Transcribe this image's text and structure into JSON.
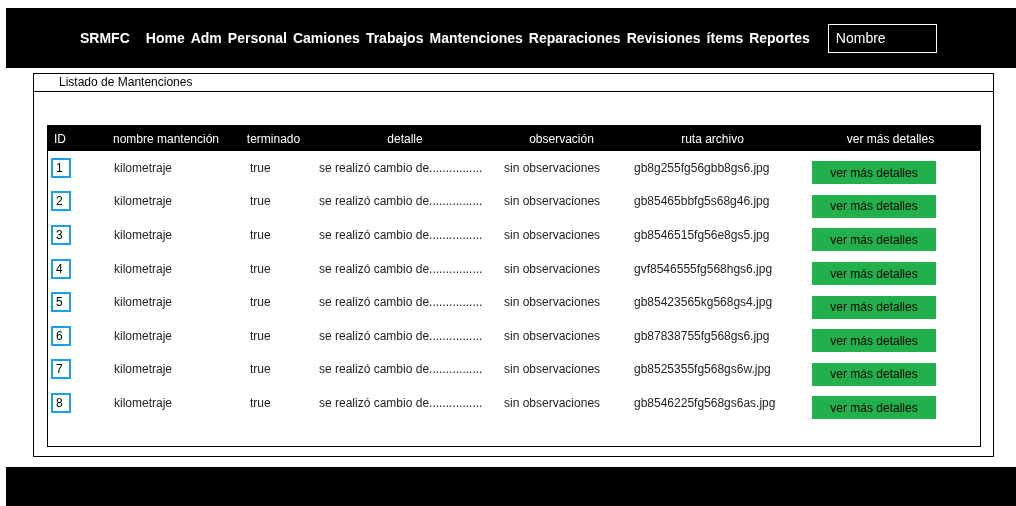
{
  "nav": {
    "brand": "SRMFC",
    "links": [
      "Home",
      "Adm",
      "Personal",
      "Camiones",
      "Trabajos",
      "Mantenciones",
      "Reparaciones",
      "Revisiones",
      "ítems",
      "Reportes"
    ],
    "search": {
      "placeholder": "Nombre"
    }
  },
  "panel": {
    "title": "Listado de Mantenciones"
  },
  "table": {
    "columns": [
      "ID",
      "nombre mantención",
      "terminado",
      "detalle",
      "observación",
      "ruta archivo",
      "ver más detalles"
    ],
    "rows": [
      {
        "id": "1",
        "name": "kilometraje",
        "done": "true",
        "detail": "se realizó cambio de................",
        "observation": "sin observaciones",
        "file": "gb8g255fg56gbb8gs6.jpg",
        "action": "ver más detalles"
      },
      {
        "id": "2",
        "name": "kilometraje",
        "done": "true",
        "detail": "se realizó cambio de................",
        "observation": "sin observaciones",
        "file": "gb85465bbfg5s68g46.jpg",
        "action": "ver más detalles"
      },
      {
        "id": "3",
        "name": "kilometraje",
        "done": "true",
        "detail": "se realizó cambio de................",
        "observation": "sin observaciones",
        "file": "gb8546515fg56e8gs5.jpg",
        "action": "ver más detalles"
      },
      {
        "id": "4",
        "name": "kilometraje",
        "done": "true",
        "detail": "se realizó cambio de................",
        "observation": "sin observaciones",
        "file": "gvf8546555fg568hgs6.jpg",
        "action": "ver más detalles"
      },
      {
        "id": "5",
        "name": "kilometraje",
        "done": "true",
        "detail": "se realizó cambio de................",
        "observation": "sin observaciones",
        "file": "gb85423565kg568gs4.jpg",
        "action": "ver más detalles"
      },
      {
        "id": "6",
        "name": "kilometraje",
        "done": "true",
        "detail": "se realizó cambio de................",
        "observation": "sin observaciones",
        "file": "gb87838755fg568gs6.jpg",
        "action": "ver más detalles"
      },
      {
        "id": "7",
        "name": "kilometraje",
        "done": "true",
        "detail": "se realizó cambio de................",
        "observation": "sin observaciones",
        "file": "gb8525355fg568gs6w.jpg",
        "action": "ver más detalles"
      },
      {
        "id": "8",
        "name": "kilometraje",
        "done": "true",
        "detail": "se realizó cambio de................",
        "observation": "sin observaciones",
        "file": "gb8546225fg568gs6as.jpg",
        "action": "ver más detalles"
      }
    ]
  }
}
